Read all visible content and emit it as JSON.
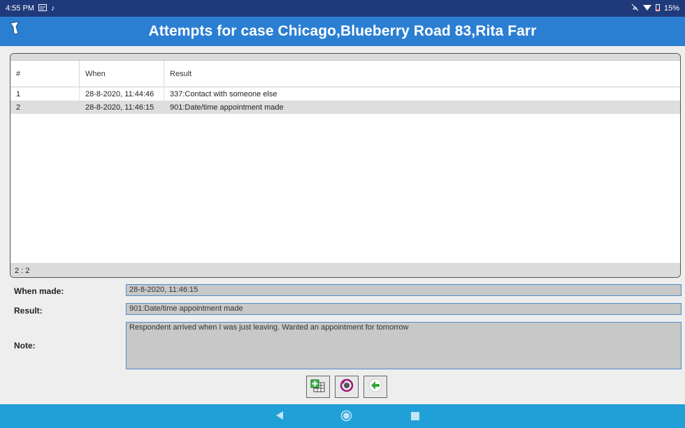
{
  "status_bar": {
    "time": "4:55 PM",
    "battery": "15%"
  },
  "app_bar": {
    "title": "Attempts for case Chicago,Blueberry Road 83,Rita Farr"
  },
  "table": {
    "columns": [
      "#",
      "When",
      "Result"
    ],
    "rows": [
      {
        "num": "1",
        "when": "28-8-2020, 11:44:46",
        "result": "337:Contact with someone else"
      },
      {
        "num": "2",
        "when": "28-8-2020, 11:46:15",
        "result": "901:Date/time appointment made"
      }
    ],
    "counter": "2 : 2"
  },
  "form": {
    "when_made_label": "When made:",
    "when_made_value": "28-8-2020, 11:46:15",
    "result_label": "Result:",
    "result_value": "901:Date/time appointment made",
    "note_label": "Note:",
    "note_value": "Respondent arrived when I was just leaving. Wanted an appointment for tomorrow"
  },
  "colors": {
    "app_bar": "#2b7fd3",
    "status_bar": "#1f3a7a",
    "nav_bar": "#21a0d8"
  }
}
